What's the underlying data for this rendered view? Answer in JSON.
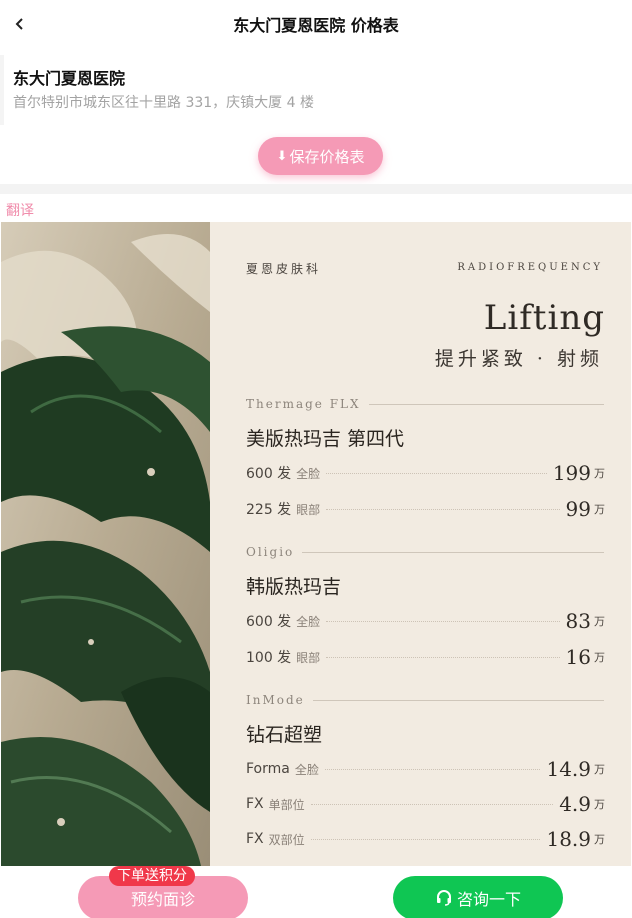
{
  "header": {
    "title": "东大门夏恩医院 价格表"
  },
  "clinic": {
    "name": "东大门夏恩医院",
    "address": "首尔特别市城东区往十里路 331，庆镇大厦 4 楼"
  },
  "actions": {
    "save_label": "保存价格表",
    "translate_label": "翻译"
  },
  "price_sheet": {
    "brand": "夏恩皮肤科",
    "category_en": "RADIOFREQUENCY",
    "title": "Lifting",
    "subtitle": "提升紧致 · 射频",
    "sections": [
      {
        "en": "Thermage FLX",
        "cn": "美版热玛吉 第四代",
        "items": [
          {
            "name": "600 发",
            "part": "全脸",
            "price": "199",
            "unit": "万"
          },
          {
            "name": "225 发",
            "part": "眼部",
            "price": "99",
            "unit": "万"
          }
        ]
      },
      {
        "en": "Oligio",
        "cn": "韩版热玛吉",
        "items": [
          {
            "name": "600 发",
            "part": "全脸",
            "price": "83",
            "unit": "万"
          },
          {
            "name": "100 发",
            "part": "眼部",
            "price": "16",
            "unit": "万"
          }
        ]
      },
      {
        "en": "InMode",
        "cn": "钻石超塑",
        "items": [
          {
            "name": "Forma",
            "part": "全脸",
            "price": "14.9",
            "unit": "万"
          },
          {
            "name": "FX",
            "part": "单部位",
            "price": "4.9",
            "unit": "万"
          },
          {
            "name": "FX",
            "part": "双部位",
            "price": "18.9",
            "unit": "万"
          }
        ]
      }
    ]
  },
  "bottom": {
    "badge": "下单送积分",
    "book_label": "预约面诊",
    "consult_label": "咨询一下"
  },
  "colors": {
    "accent_pink": "#f59ab6",
    "accent_green": "#0fc653",
    "badge_red": "#f0384a"
  }
}
